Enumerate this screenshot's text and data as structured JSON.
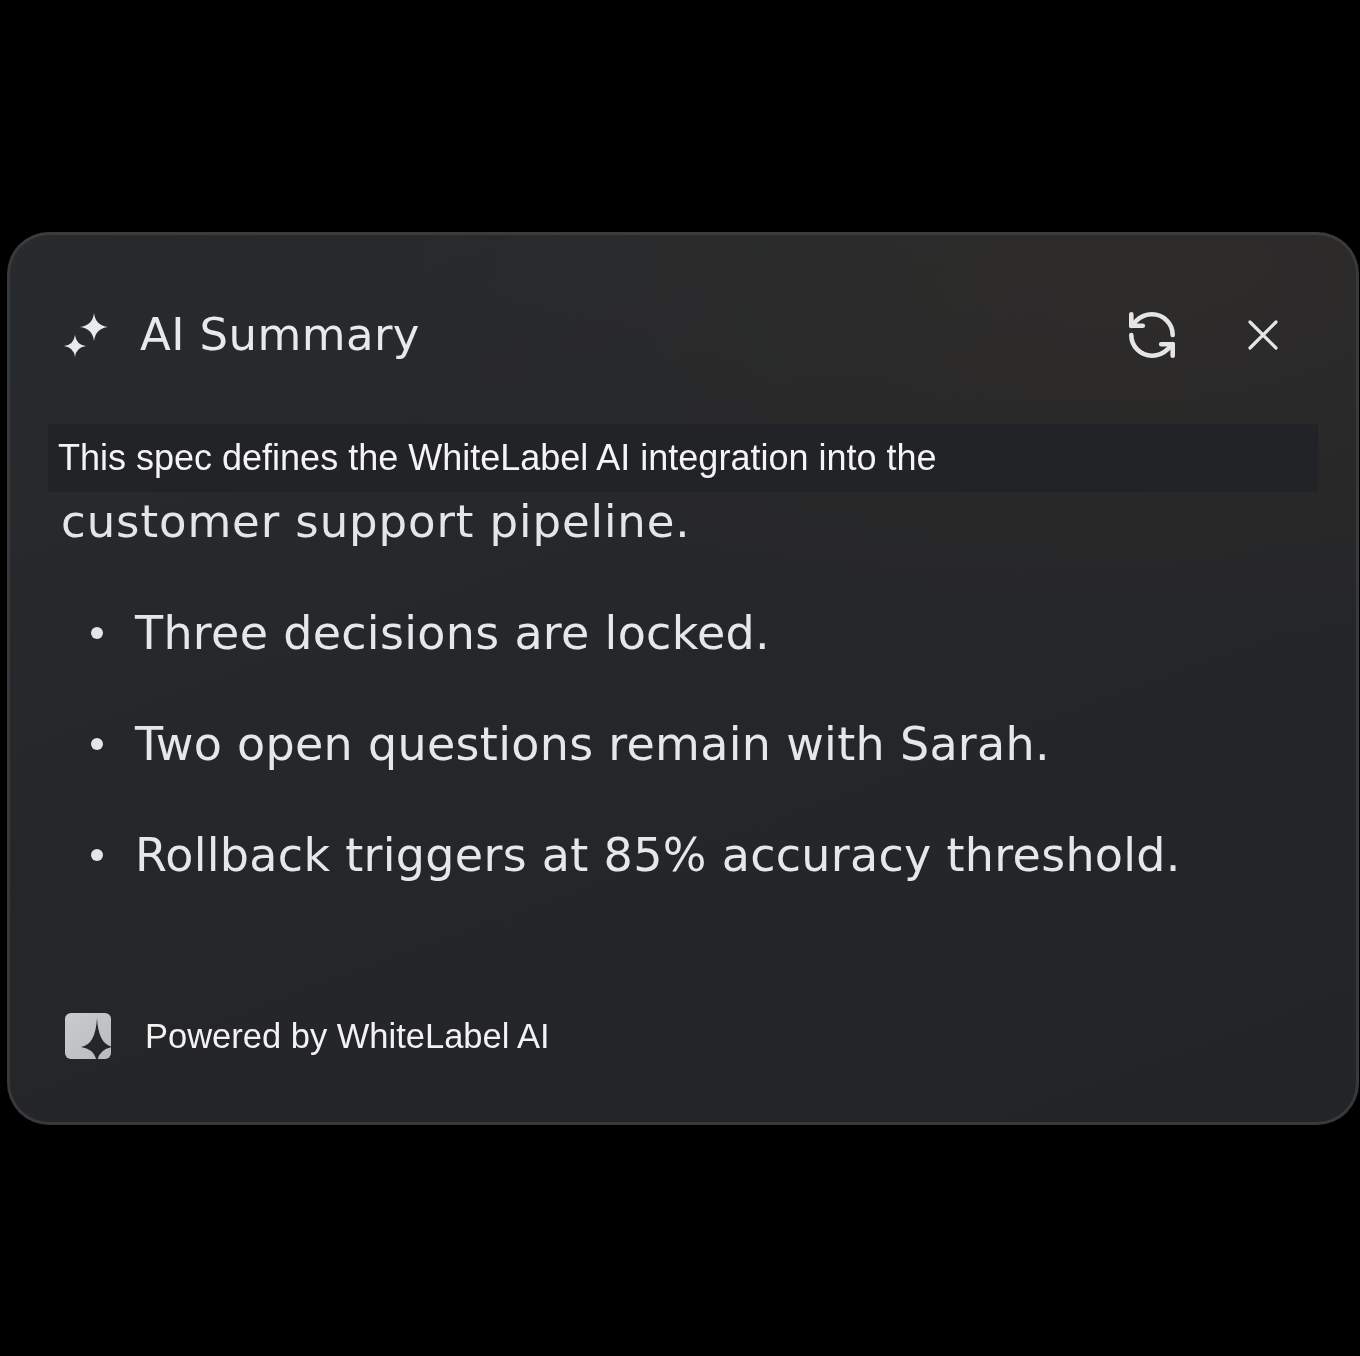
{
  "header": {
    "title": "AI Summary"
  },
  "summary": {
    "lines": [
      {
        "text": "This spec defines the WhiteLabel AI integration into the",
        "highlighted": true
      },
      {
        "text": "customer support pipeline.",
        "highlighted": false
      }
    ]
  },
  "bullets": [
    "Three decisions are locked.",
    "Two open questions remain with Sarah.",
    "Rollback triggers at 85% accuracy threshold."
  ],
  "footer": {
    "text": "Powered by WhiteLabel AI"
  }
}
